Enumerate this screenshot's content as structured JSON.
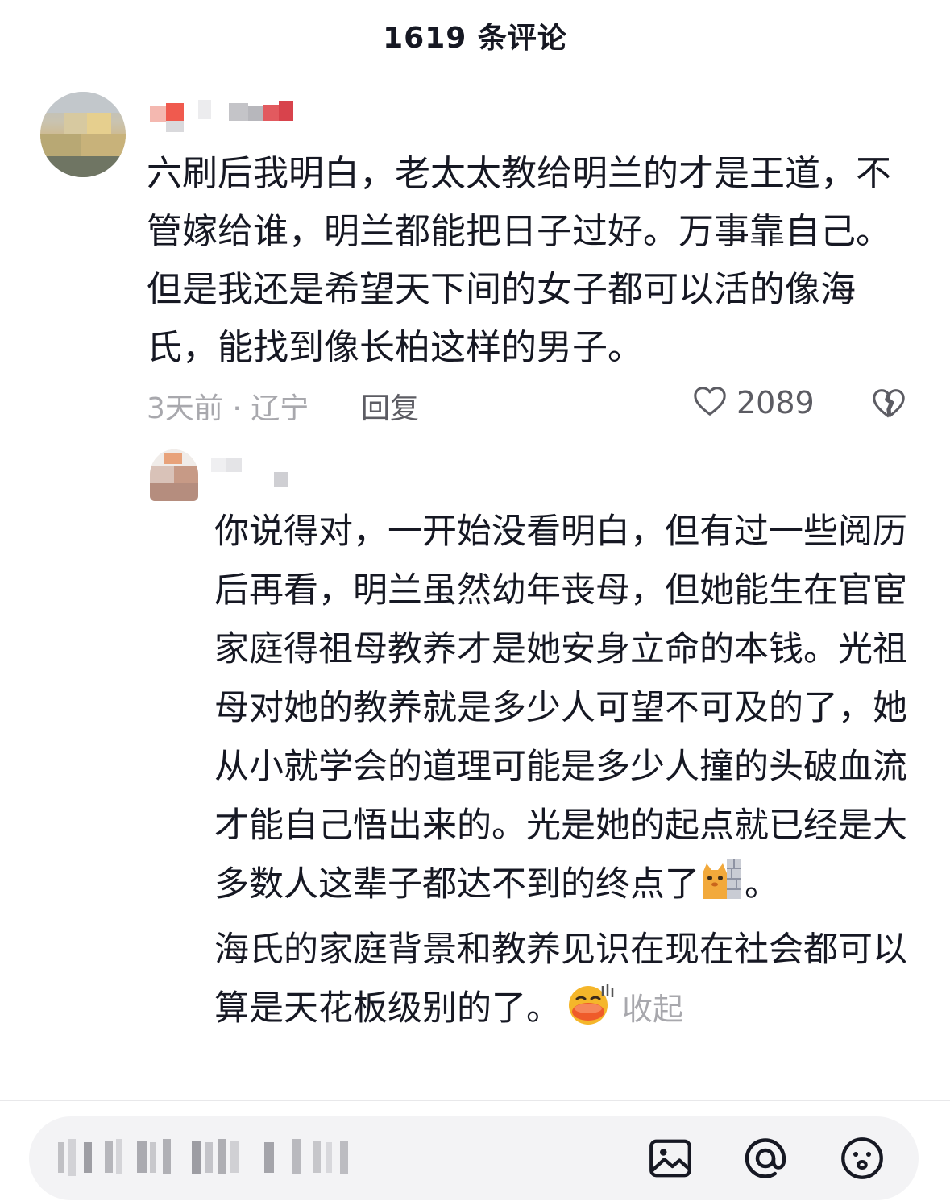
{
  "header": {
    "title": "1619 条评论"
  },
  "comment": {
    "username_blurred": true,
    "text": "六刷后我明白，老太太教给明兰的才是王道，不管嫁给谁，明兰都能把日子过好。万事靠自己。但是我还是希望天下间的女子都可以活的像海氏，能找到像长柏这样的男子。",
    "meta": "3天前 · 辽宁",
    "reply_label": "回复",
    "like_count": "2089",
    "like_icon": "heart-outline-icon",
    "dislike_icon": "broken-heart-icon"
  },
  "reply": {
    "username_blurred": true,
    "paragraph1_before_emoji": "你说得对，一开始没看明白，但有过一些阅历后再看，明兰虽然幼年丧母，但她能生在官宦家庭得祖母教养才是她安身立命的本钱。光祖母对她的教养就是多少人可望不可及的了，她从小就学会的道理可能是多少人撞的头破血流才能自己悟出来的。光是她的起点就已经是大多数人这辈子都达不到的终点了",
    "paragraph1_emoji": "cat-peeking-wall-emoji",
    "paragraph1_after_emoji": "。",
    "paragraph2": "海氏的家庭背景和教养见识在现在社会都可以算是天花板级别的了。",
    "paragraph2_emoji": "sweating-duck-emoji",
    "collapse_label": "收起"
  },
  "input_bar": {
    "placeholder_blurred": true,
    "icons": [
      "image-icon",
      "at-icon",
      "emoji-face-icon"
    ]
  }
}
